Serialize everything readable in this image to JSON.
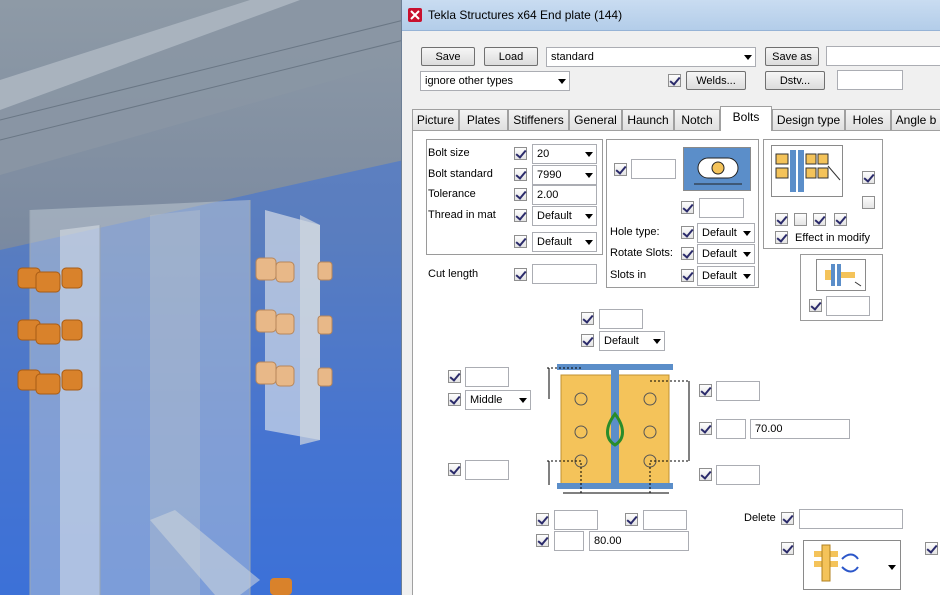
{
  "window": {
    "title": "Tekla Structures x64  End plate (144)"
  },
  "toolbar": {
    "save_label": "Save",
    "load_label": "Load",
    "preset_value": "standard",
    "save_as_label": "Save as",
    "save_as_value": "",
    "filter_value": "ignore other types",
    "welds_label": "Welds...",
    "dstv_label": "Dstv...",
    "dstv_value": ""
  },
  "tabs": [
    {
      "label": "Picture"
    },
    {
      "label": "Plates"
    },
    {
      "label": "Stiffeners"
    },
    {
      "label": "General"
    },
    {
      "label": "Haunch"
    },
    {
      "label": "Notch"
    },
    {
      "label": "Bolts"
    },
    {
      "label": "Design type"
    },
    {
      "label": "Holes"
    },
    {
      "label": "Angle b"
    }
  ],
  "active_tab": "Bolts",
  "bolt_props": {
    "size_label": "Bolt size",
    "size_value": "20",
    "standard_label": "Bolt standard",
    "standard_value": "7990",
    "tolerance_label": "Tolerance",
    "tolerance_value": "2.00",
    "thread_label": "Thread in mat",
    "thread_value": "Default",
    "extra_value": "Default",
    "cut_length_label": "Cut length",
    "cut_length_value": ""
  },
  "hole_props": {
    "hole_type_label": "Hole type:",
    "hole_type_value": "Default",
    "rotate_label": "Rotate Slots:",
    "rotate_value": "Default",
    "slots_in_label": "Slots in",
    "slots_in_value": "Default"
  },
  "assembly": {
    "effect_label": "Effect in modify"
  },
  "layout": {
    "top_dist_value": "",
    "top_default_value": "Default",
    "left_top_value": "",
    "middle_value": "Middle",
    "left_bottom_value": "",
    "right_top_value": "",
    "right_mid_small_value": "",
    "right_mid_value": "70.00",
    "right_bottom_value": "",
    "bottom_left_value": "",
    "bottom_right_value": "",
    "bottom_small_value": "",
    "bottom_value": "80.00",
    "delete_label": "Delete",
    "delete_value": ""
  },
  "colors": {
    "title_bar": "#bcd4ee",
    "plate": "#f4c35a",
    "beam": "#5b8ec9",
    "accent": "#2a8c2a"
  }
}
